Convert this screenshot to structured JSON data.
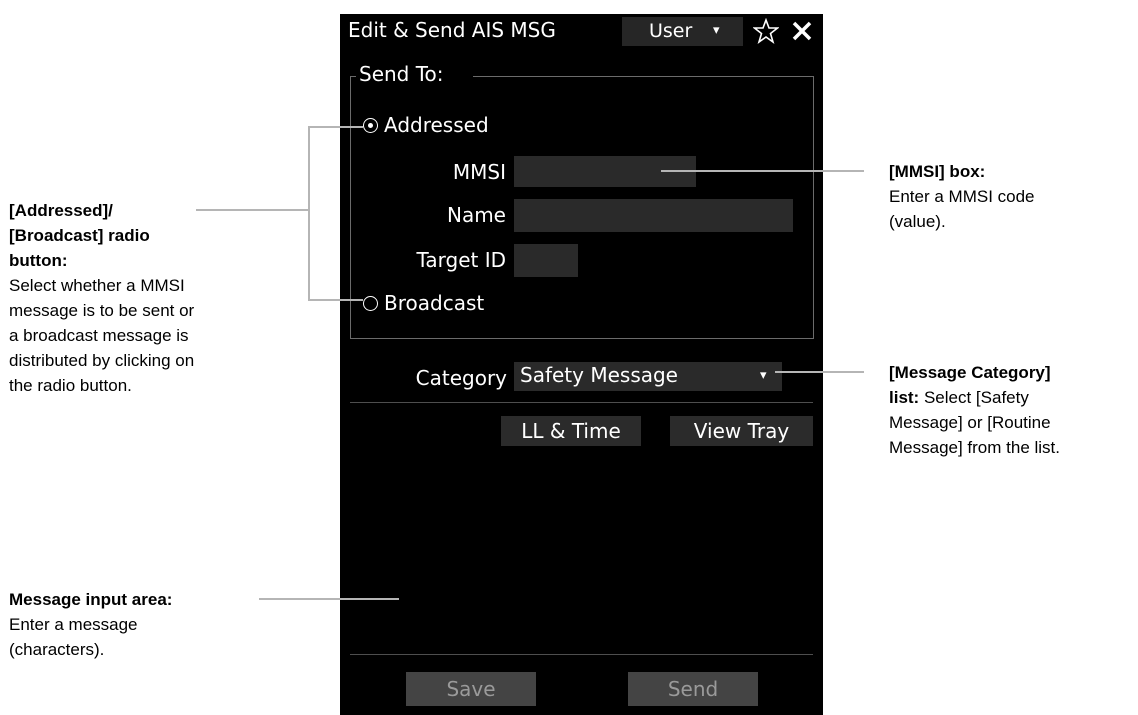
{
  "dialog": {
    "title": "Edit & Send AIS MSG",
    "user_label": "User",
    "caret": "▾",
    "star_icon": "star-icon",
    "close_icon": "close-icon"
  },
  "send_to": {
    "title": "Send To:",
    "addressed_label": "Addressed",
    "addressed_selected": true,
    "broadcast_label": "Broadcast",
    "broadcast_selected": false,
    "mmsi_label": "MMSI",
    "mmsi_value": "",
    "name_label": "Name",
    "name_value": "",
    "target_id_label": "Target ID",
    "target_id_value": ""
  },
  "category": {
    "label": "Category",
    "value": "Safety Message",
    "caret": "▾"
  },
  "buttons": {
    "ll_time": "LL & Time",
    "view_tray": "View Tray",
    "save": "Save",
    "send": "Send"
  },
  "callouts": {
    "radio_title_1": "[Addressed]/",
    "radio_title_2": "[Broadcast] radio",
    "radio_title_3": "button:",
    "radio_desc_1": "Select whether a MMSI",
    "radio_desc_2": "message is to be sent or",
    "radio_desc_3": "a broadcast message is",
    "radio_desc_4": "distributed by clicking on",
    "radio_desc_5": "the radio button.",
    "mmsi_title": "[MMSI] box:",
    "mmsi_desc_1": "Enter a MMSI code",
    "mmsi_desc_2": "(value).",
    "category_title_1": "[Message Category]",
    "category_title_2": "list:",
    "category_desc_1": " Select [Safety",
    "category_desc_2": "Message] or [Routine",
    "category_desc_3": "Message] from the list.",
    "message_title": "Message input area:",
    "message_desc_1": "Enter a message",
    "message_desc_2": "(characters)."
  },
  "colors": {
    "panel_bg": "#000000",
    "field_bg": "#2a2a2a",
    "callout_line": "#b5b5b5"
  }
}
